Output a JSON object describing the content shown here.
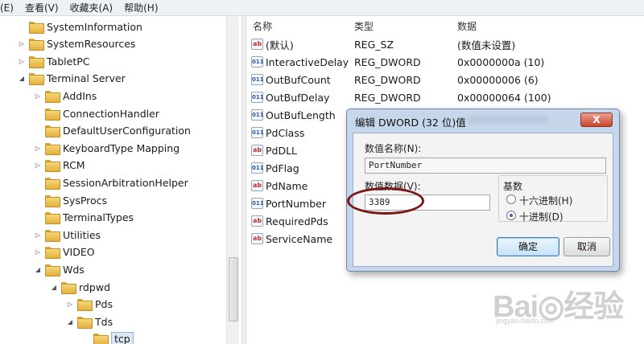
{
  "menubar": [
    "(E)",
    "查看(V)",
    "收藏夹(A)",
    "帮助(H)"
  ],
  "tree": [
    {
      "label": "SystemInformation",
      "depth": 0,
      "expander": ""
    },
    {
      "label": "SystemResources",
      "depth": 0,
      "expander": "▷"
    },
    {
      "label": "TabletPC",
      "depth": 0,
      "expander": "▷"
    },
    {
      "label": "Terminal Server",
      "depth": 0,
      "expander": "◢"
    },
    {
      "label": "AddIns",
      "depth": 1,
      "expander": "▷"
    },
    {
      "label": "ConnectionHandler",
      "depth": 1,
      "expander": ""
    },
    {
      "label": "DefaultUserConfiguration",
      "depth": 1,
      "expander": ""
    },
    {
      "label": "KeyboardType Mapping",
      "depth": 1,
      "expander": "▷"
    },
    {
      "label": "RCM",
      "depth": 1,
      "expander": "▷"
    },
    {
      "label": "SessionArbitrationHelper",
      "depth": 1,
      "expander": ""
    },
    {
      "label": "SysProcs",
      "depth": 1,
      "expander": ""
    },
    {
      "label": "TerminalTypes",
      "depth": 1,
      "expander": ""
    },
    {
      "label": "Utilities",
      "depth": 1,
      "expander": "▷"
    },
    {
      "label": "VIDEO",
      "depth": 1,
      "expander": "▷"
    },
    {
      "label": "Wds",
      "depth": 1,
      "expander": "◢"
    },
    {
      "label": "rdpwd",
      "depth": 2,
      "expander": "◢"
    },
    {
      "label": "Pds",
      "depth": 3,
      "expander": "▷"
    },
    {
      "label": "Tds",
      "depth": 3,
      "expander": "◢"
    },
    {
      "label": "tcp",
      "depth": 4,
      "expander": "",
      "selected": true
    }
  ],
  "columns": {
    "name": "名称",
    "type": "类型",
    "data": "数据"
  },
  "values": [
    {
      "icon": "ab",
      "name": "(默认)",
      "type": "REG_SZ",
      "data": "(数值未设置)"
    },
    {
      "icon": "bin",
      "name": "InteractiveDelay",
      "type": "REG_DWORD",
      "data": "0x0000000a (10)"
    },
    {
      "icon": "bin",
      "name": "OutBufCount",
      "type": "REG_DWORD",
      "data": "0x00000006 (6)"
    },
    {
      "icon": "bin",
      "name": "OutBufDelay",
      "type": "REG_DWORD",
      "data": "0x00000064 (100)"
    },
    {
      "icon": "bin",
      "name": "OutBufLength",
      "type": "",
      "data": ""
    },
    {
      "icon": "bin",
      "name": "PdClass",
      "type": "",
      "data": ""
    },
    {
      "icon": "ab",
      "name": "PdDLL",
      "type": "",
      "data": ""
    },
    {
      "icon": "bin",
      "name": "PdFlag",
      "type": "",
      "data": ""
    },
    {
      "icon": "ab",
      "name": "PdName",
      "type": "",
      "data": ""
    },
    {
      "icon": "bin",
      "name": "PortNumber",
      "type": "",
      "data": ""
    },
    {
      "icon": "ab",
      "name": "RequiredPds",
      "type": "",
      "data": ""
    },
    {
      "icon": "ab",
      "name": "ServiceName",
      "type": "",
      "data": ""
    }
  ],
  "dialog": {
    "title": "编辑 DWORD (32 位)值",
    "close": "X",
    "name_label": "数值名称(N):",
    "name_value": "PortNumber",
    "data_label": "数值数据(V):",
    "data_value": "3389",
    "base_label": "基数",
    "hex_label": "十六进制(H)",
    "dec_label": "十进制(D)",
    "base_selected": "dec",
    "ok": "确定",
    "cancel": "取消"
  },
  "watermark": {
    "main": "Bai◎经验",
    "sub": "jingyan.baidu.com"
  },
  "colors": {
    "dialog_frame": "#c6d7ec",
    "highlight_ellipse": "#7a1516",
    "close_button": "#c9452f"
  }
}
